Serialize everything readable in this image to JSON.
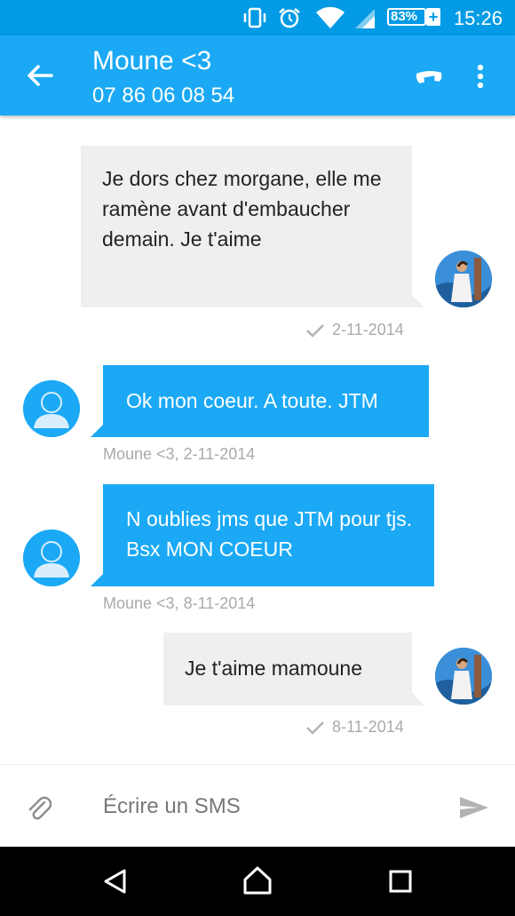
{
  "status": {
    "battery": "83%",
    "time": "15:26",
    "icons": [
      "vibrate-icon",
      "alarm-icon",
      "wifi-icon",
      "signal-icon",
      "battery-icon"
    ]
  },
  "header": {
    "contact_name": "Moune <3",
    "phone_number": "07 86 06 08 54"
  },
  "messages": [
    {
      "direction": "outgoing",
      "text": "Je dors chez morgane, elle me ramène avant d'embaucher demain. Je t'aime",
      "meta": "2-11-2014"
    },
    {
      "direction": "incoming",
      "text": "Ok mon coeur. A toute. JTM",
      "meta": "Moune <3, 2-11-2014"
    },
    {
      "direction": "incoming",
      "text": "N oublies jms que JTM pour tjs. Bsx MON COEUR",
      "meta": "Moune <3, 8-11-2014"
    },
    {
      "direction": "outgoing",
      "text": "Je t'aime mamoune",
      "meta": "8-11-2014"
    }
  ],
  "composer": {
    "placeholder": "Écrire un SMS"
  },
  "colors": {
    "status_bar": "#039be5",
    "app_bar": "#1ba9f5",
    "incoming_bubble": "#1ba9f5",
    "outgoing_bubble": "#efefef"
  }
}
